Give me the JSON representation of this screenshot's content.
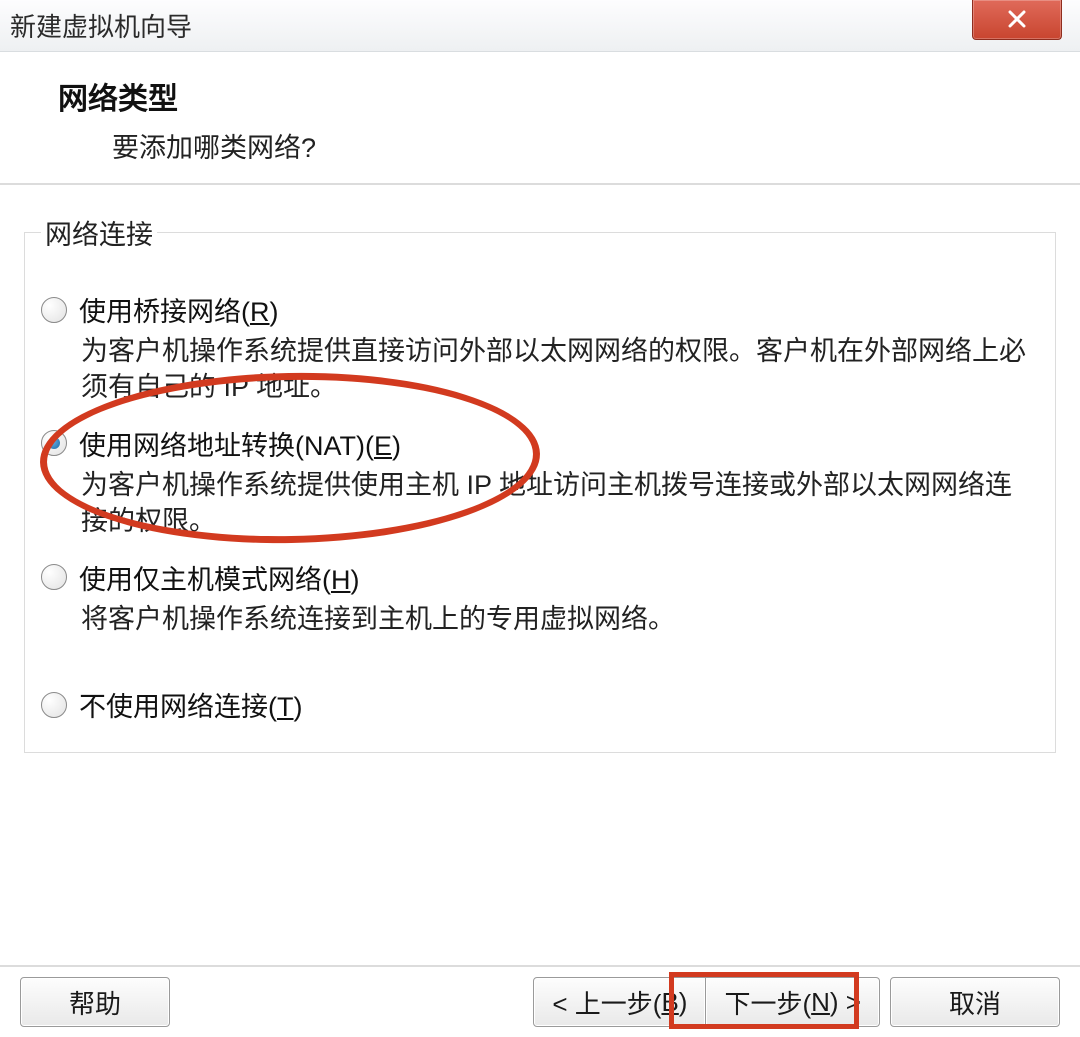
{
  "window": {
    "title": "新建虚拟机向导"
  },
  "header": {
    "title": "网络类型",
    "subtitle": "要添加哪类网络?"
  },
  "group": {
    "legend": "网络连接"
  },
  "options": {
    "bridged": {
      "label_pre": "使用桥接网络(",
      "hot": "R",
      "label_post": ")",
      "desc": "为客户机操作系统提供直接访问外部以太网网络的权限。客户机在外部网络上必须有自己的 IP 地址。"
    },
    "nat": {
      "label_pre": "使用网络地址转换(NAT)(",
      "hot": "E",
      "label_post": ")",
      "desc": "为客户机操作系统提供使用主机 IP 地址访问主机拨号连接或外部以太网网络连接的权限。"
    },
    "hostonly": {
      "label_pre": "使用仅主机模式网络(",
      "hot": "H",
      "label_post": ")",
      "desc": "将客户机操作系统连接到主机上的专用虚拟网络。"
    },
    "none": {
      "label_pre": "不使用网络连接(",
      "hot": "T",
      "label_post": ")"
    }
  },
  "buttons": {
    "help": "帮助",
    "back_pre": "< 上一步(",
    "back_hot": "B",
    "back_post": ")",
    "next_pre": "下一步(",
    "next_hot": "N",
    "next_post": ") >",
    "cancel": "取消"
  }
}
